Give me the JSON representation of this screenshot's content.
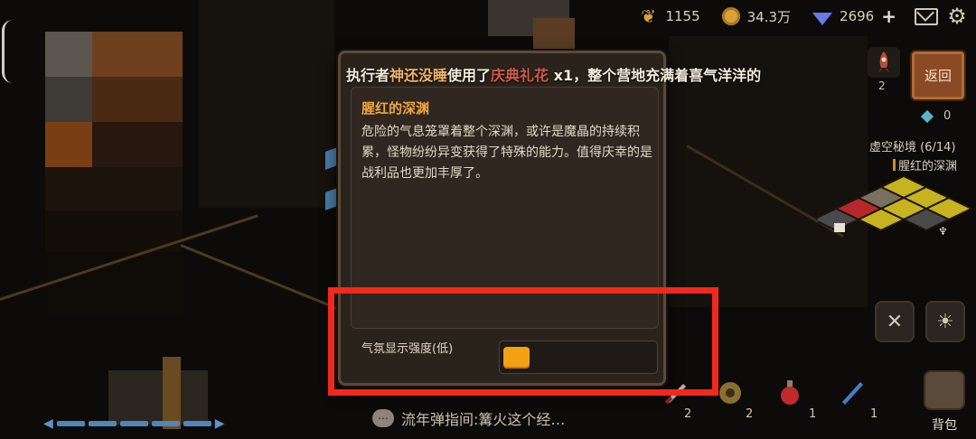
{
  "resources": {
    "food": "1155",
    "gold": "34.3万",
    "gems": "2696"
  },
  "icons": {
    "food": "wheat-icon",
    "gold": "coin-icon",
    "gems": "diamond-icon",
    "add": "plus-icon",
    "mail": "mail-icon",
    "settings": "gear-icon"
  },
  "announcement": {
    "prefix": "执行者",
    "actor": "神还没睡",
    "verb": "使用了",
    "item": "庆典礼花",
    "suffix": " x1，整个营地充满着喜气洋洋的"
  },
  "panel": {
    "title": "腥红的深渊",
    "description": "危险的气息笼罩着整个深渊，或许是魔晶的持续积累，怪物纷纷异变获得了特殊的能力。值得庆幸的是战利品也更加丰厚了。",
    "setting_label": "气氛显示强度(低)",
    "intensity_level": "low",
    "intensity_fraction": 0.0
  },
  "sidebar": {
    "back_label": "返回",
    "rocket_count": "2",
    "crystal_count": "0",
    "dungeon_name": "虚空秘境 (6/14)",
    "dungeon_sub": "腥红的深渊"
  },
  "bottom": {
    "chat_text": "流年弹指间:篝火这个经…",
    "bag_label": "背包",
    "item_counts": [
      "2",
      "2",
      "1",
      "1"
    ]
  },
  "colors": {
    "accent_orange": "#f3a112",
    "title_orange": "#f0a640",
    "highlight_red": "#f2281c",
    "panel_bg": "#2a231c",
    "hp_blue": "#4f86b8"
  }
}
